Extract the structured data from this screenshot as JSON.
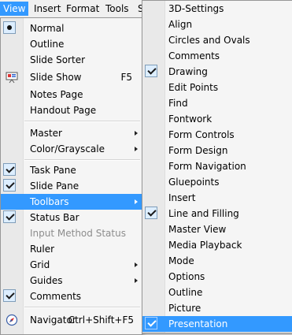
{
  "menubar": {
    "items": [
      {
        "label": "View",
        "active": true
      },
      {
        "label": "Insert"
      },
      {
        "label": "Format"
      },
      {
        "label": "Tools"
      },
      {
        "label": "S"
      }
    ]
  },
  "view_menu": {
    "items": [
      {
        "label": "Normal",
        "shortcut": "",
        "state": "radio"
      },
      {
        "label": "Outline"
      },
      {
        "label": "Slide Sorter"
      },
      {
        "label": "Slide Show",
        "shortcut": "F5",
        "icon": "slide-show-icon"
      },
      {
        "label": "Notes Page"
      },
      {
        "label": "Handout Page"
      },
      {
        "label": "Master",
        "submenu": true
      },
      {
        "label": "Color/Grayscale",
        "submenu": true
      },
      {
        "label": "Task Pane",
        "state": "checked"
      },
      {
        "label": "Slide Pane",
        "state": "checked"
      },
      {
        "label": "Toolbars",
        "submenu": true,
        "highlighted": true
      },
      {
        "label": "Status Bar",
        "state": "checked"
      },
      {
        "label": "Input Method Status",
        "disabled": true
      },
      {
        "label": "Ruler"
      },
      {
        "label": "Grid",
        "submenu": true
      },
      {
        "label": "Guides",
        "submenu": true
      },
      {
        "label": "Comments",
        "state": "checked"
      },
      {
        "label": "Navigator",
        "shortcut": "Ctrl+Shift+F5",
        "icon": "navigator-icon"
      }
    ]
  },
  "toolbars_submenu": {
    "items": [
      {
        "label": "3D-Settings"
      },
      {
        "label": "Align"
      },
      {
        "label": "Circles and Ovals"
      },
      {
        "label": "Comments"
      },
      {
        "label": "Drawing",
        "checked": true
      },
      {
        "label": "Edit Points"
      },
      {
        "label": "Find"
      },
      {
        "label": "Fontwork"
      },
      {
        "label": "Form Controls"
      },
      {
        "label": "Form Design"
      },
      {
        "label": "Form Navigation"
      },
      {
        "label": "Gluepoints"
      },
      {
        "label": "Insert"
      },
      {
        "label": "Line and Filling",
        "checked": true
      },
      {
        "label": "Master View"
      },
      {
        "label": "Media Playback"
      },
      {
        "label": "Mode"
      },
      {
        "label": "Options"
      },
      {
        "label": "Outline"
      },
      {
        "label": "Picture"
      },
      {
        "label": "Presentation",
        "checked": true,
        "highlighted": true
      }
    ]
  },
  "colors": {
    "highlight": "#3399ff",
    "menu_bg": "#f5f5f5",
    "disabled_text": "#8d8d8d"
  }
}
